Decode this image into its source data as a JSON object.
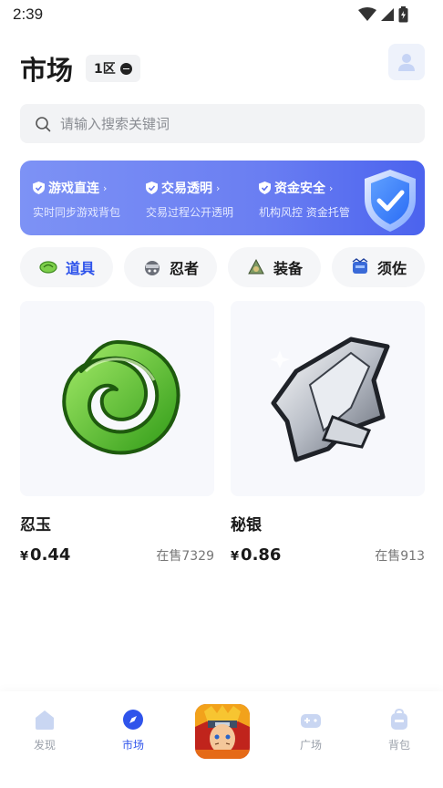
{
  "status_bar": {
    "time": "2:39"
  },
  "header": {
    "title": "市场",
    "zone_label": "1区"
  },
  "search": {
    "placeholder": "请输入搜索关键词"
  },
  "banner": {
    "features": [
      {
        "title": "游戏直连",
        "subtitle": "实时同步游戏背包"
      },
      {
        "title": "交易透明",
        "subtitle": "交易过程公开透明"
      },
      {
        "title": "资金安全",
        "subtitle": "机构风控 资金托管"
      }
    ]
  },
  "categories": [
    {
      "label": "道具",
      "icon": "jade-leaf-icon",
      "active": true
    },
    {
      "label": "忍者",
      "icon": "ninja-icon",
      "active": false
    },
    {
      "label": "装备",
      "icon": "equipment-icon",
      "active": false
    },
    {
      "label": "须佐",
      "icon": "susanoo-icon",
      "active": false
    }
  ],
  "items": [
    {
      "name": "忍玉",
      "currency": "¥",
      "price": "0.44",
      "stock": "在售7329"
    },
    {
      "name": "秘银",
      "currency": "¥",
      "price": "0.86",
      "stock": "在售913"
    }
  ],
  "tabbar": {
    "tabs": [
      {
        "label": "发现"
      },
      {
        "label": "市场"
      },
      {
        "label": "广场"
      },
      {
        "label": "背包"
      }
    ]
  },
  "colors": {
    "accent": "#2f54eb",
    "banner_start": "#7d92f5",
    "banner_end": "#4b63ee",
    "jade_green": "#5cc52f"
  }
}
